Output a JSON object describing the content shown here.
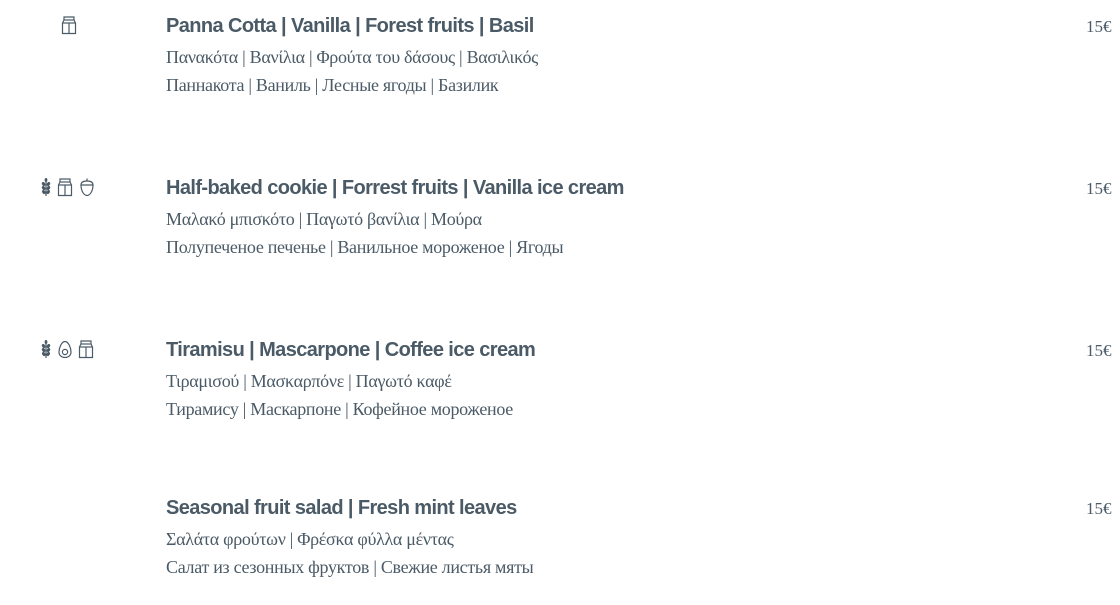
{
  "menu": {
    "items": [
      {
        "title": "Panna Cotta | Vanilla | Forest fruits | Basil",
        "greek": "Πανακότα | Βανίλια | Φρούτα του δάσους | Βασιλικός",
        "russian": "Паннакота | Ваниль | Лесные ягоды | Базилик",
        "price": "15€",
        "icons": [
          "milk-carton-icon"
        ]
      },
      {
        "title": "Half-baked cookie | Forrest fruits | Vanilla ice cream",
        "greek": "Μαλακό μπισκότο | Παγωτό βανίλια | Μούρα",
        "russian": "Полупеченое печенье | Ванильное мороженое | Ягоды",
        "price": "15€",
        "icons": [
          "wheat-icon",
          "milk-carton-icon",
          "nut-icon"
        ]
      },
      {
        "title": "Tiramisu | Mascarpone | Coffee ice cream",
        "greek": "Τιραμισού | Μασκαρπόνε | Παγωτό καφέ",
        "russian": "Тирамису | Маскарпоне | Кофейное мороженое",
        "price": "15€",
        "icons": [
          "wheat-icon",
          "egg-icon",
          "milk-carton-icon"
        ]
      },
      {
        "title": "Seasonal fruit salad | Fresh mint leaves",
        "greek": "Σαλάτα φρούτων | Φρέσκα φύλλα μέντας",
        "russian": "Салат из сезонных фруктов | Свежие листья мяты",
        "price": "15€",
        "icons": []
      }
    ]
  }
}
